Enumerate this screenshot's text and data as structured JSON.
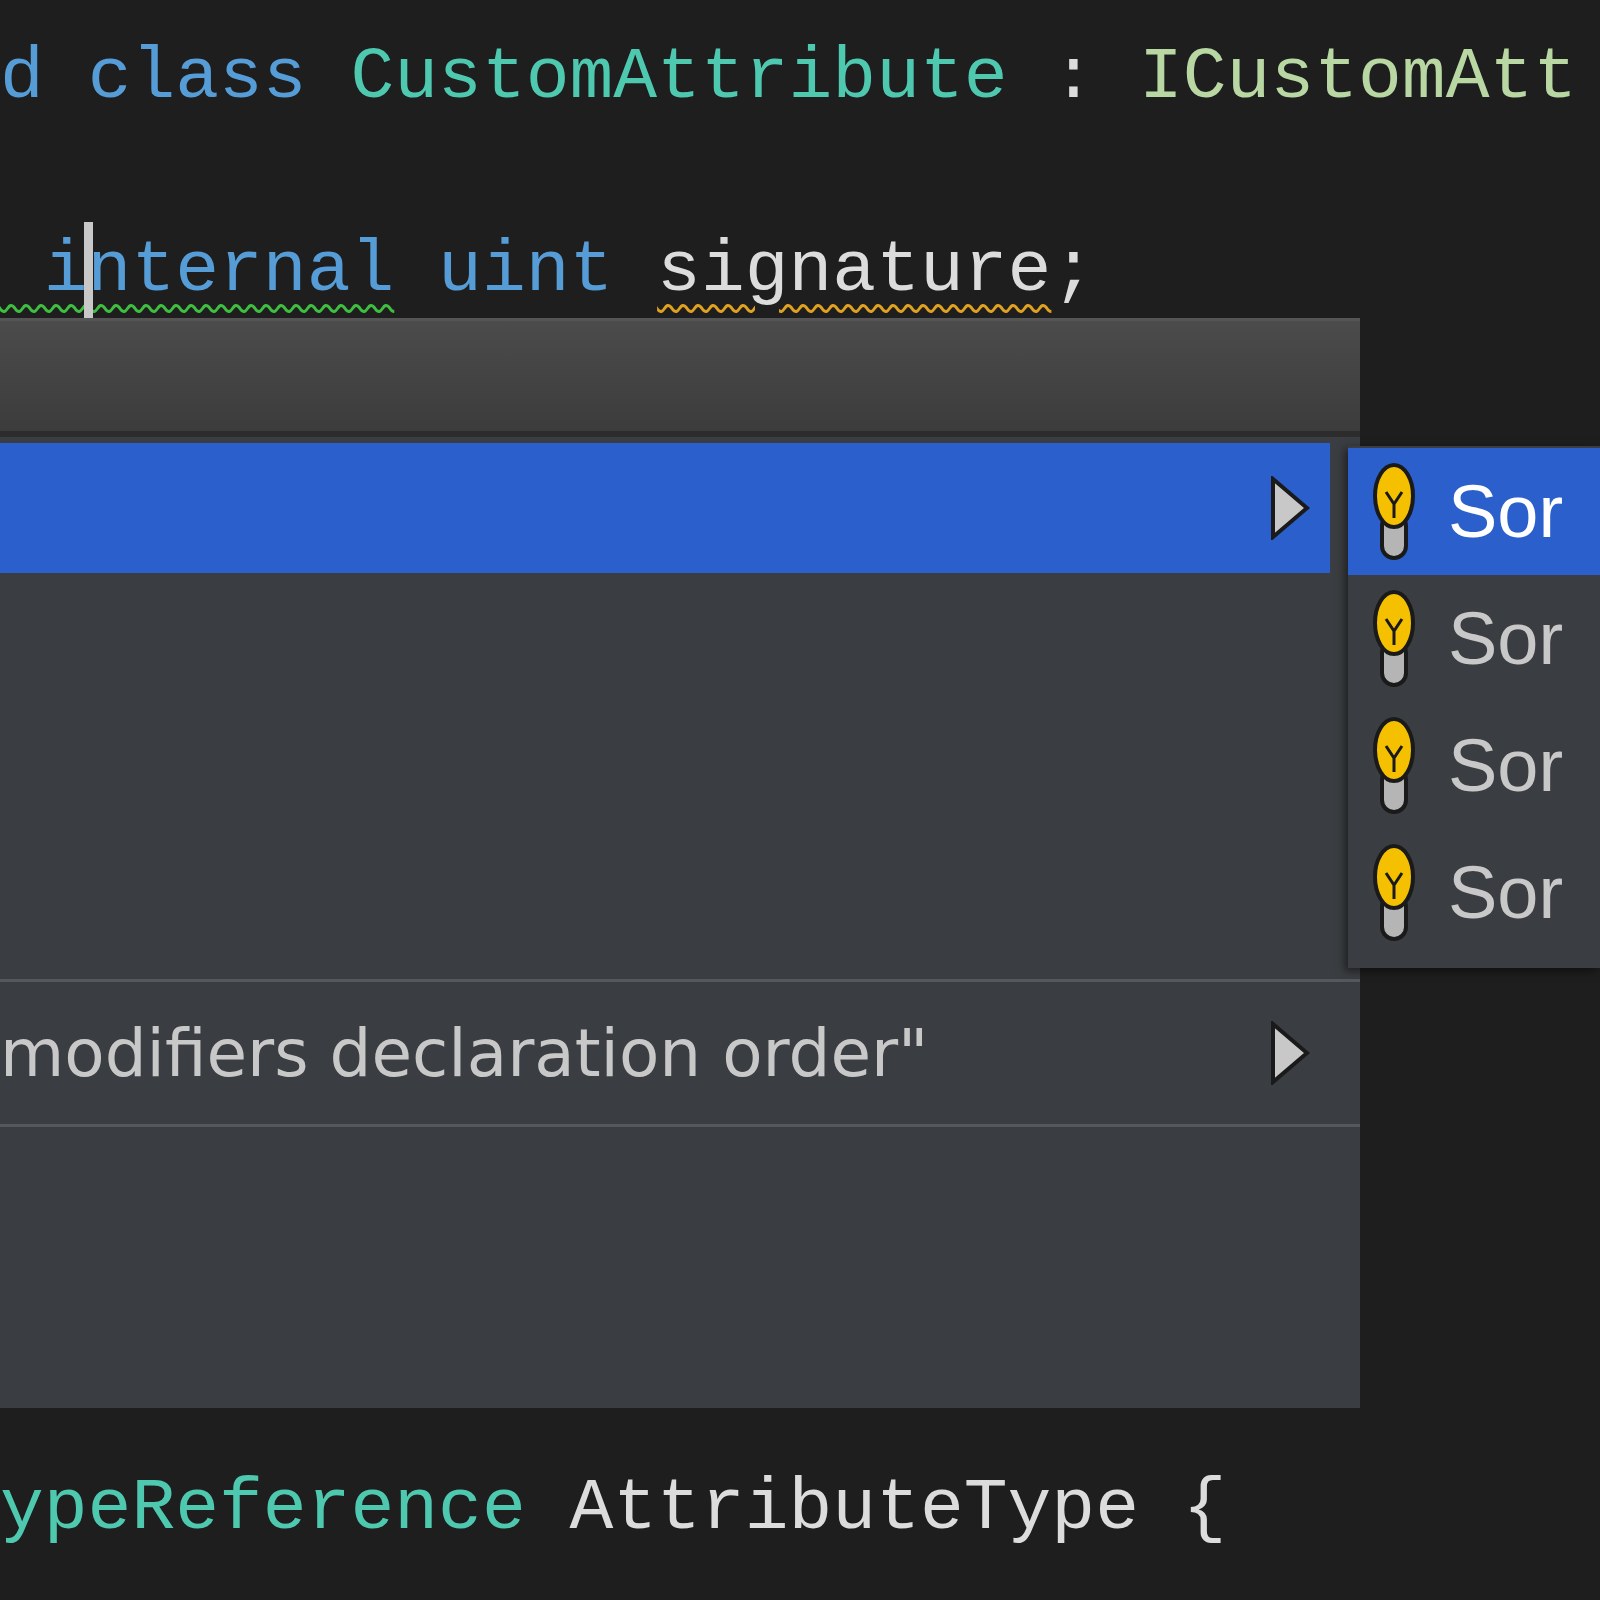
{
  "editor": {
    "lines_above": [
      {
        "tokens": [
          {
            "text": "d ",
            "kind": "keyword"
          },
          {
            "text": "class ",
            "kind": "keyword"
          },
          {
            "text": "CustomAttribute",
            "kind": "type"
          },
          {
            "text": " : ",
            "kind": "plain"
          },
          {
            "text": "ICustomAtt",
            "kind": "interface"
          }
        ]
      },
      {
        "tokens": [
          {
            "text": " internal",
            "kind": "keyword",
            "suggestion": true,
            "warning": false
          },
          {
            "text": " uint ",
            "kind": "keyword",
            "suggestion": false,
            "warning": false
          },
          {
            "text": "signature",
            "kind": "plain",
            "suggestion": false,
            "warning": true
          },
          {
            "text": ";",
            "kind": "plain",
            "suggestion": false,
            "warning": false
          }
        ]
      }
    ],
    "lines_below": [
      {
        "tokens": [
          {
            "text": "ypeReference",
            "kind": "type"
          },
          {
            "text": " AttributeType {",
            "kind": "plain"
          }
        ]
      }
    ]
  },
  "context_menu": {
    "items": [
      {
        "kind": "header"
      },
      {
        "kind": "item",
        "selected": true,
        "submenu": true
      },
      {
        "kind": "blank"
      },
      {
        "kind": "separator"
      },
      {
        "kind": "item",
        "label": "modifiers declaration order\"",
        "selected": false,
        "submenu": true
      },
      {
        "kind": "separator"
      },
      {
        "kind": "blank"
      }
    ]
  },
  "submenu": {
    "items": [
      {
        "label": "Sor",
        "selected": true
      },
      {
        "label": "Sor",
        "selected": false
      },
      {
        "label": "Sor",
        "selected": false
      },
      {
        "label": "Sor",
        "selected": false
      }
    ]
  }
}
